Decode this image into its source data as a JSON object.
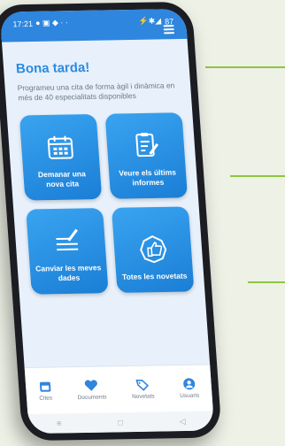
{
  "status": {
    "time": "17:21",
    "battery": "87"
  },
  "greeting": "Bona tarda!",
  "intro": "Programeu una cita de forma àgil i dinàmica en més de 40 especialitats disponibles",
  "tiles": [
    {
      "label": "Demanar una nova cita",
      "icon": "calendar-icon"
    },
    {
      "label": "Veure els últims informes",
      "icon": "report-icon"
    },
    {
      "label": "Canviar les meves dades",
      "icon": "edit-lines-icon"
    },
    {
      "label": "Totes les novetats",
      "icon": "thumbs-up-icon"
    }
  ],
  "nav": [
    {
      "label": "Cites",
      "icon": "calendar-nav-icon"
    },
    {
      "label": "Documents",
      "icon": "heart-icon"
    },
    {
      "label": "Novetats",
      "icon": "tag-icon"
    },
    {
      "label": "Usuaris",
      "icon": "user-icon"
    }
  ],
  "colors": {
    "primary": "#2e86de",
    "accent_line": "#8cc63f",
    "text_muted": "#6c7a89"
  }
}
